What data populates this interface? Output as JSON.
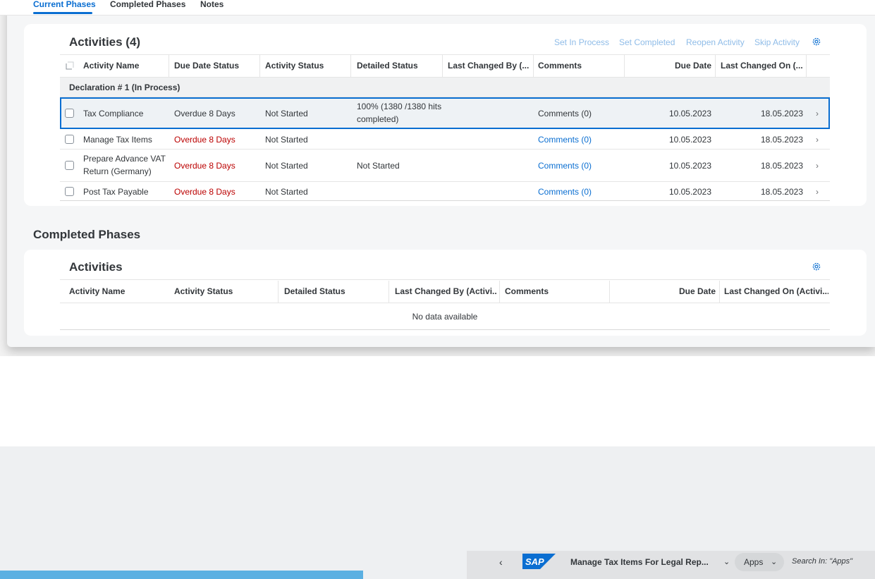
{
  "tabs": [
    {
      "label": "Current Phases",
      "active": true
    },
    {
      "label": "Completed Phases",
      "active": false
    },
    {
      "label": "Notes",
      "active": false
    }
  ],
  "current": {
    "title": "Activities (4)",
    "toolbar": [
      "Set In Process",
      "Set Completed",
      "Reopen Activity",
      "Skip Activity"
    ],
    "columns": [
      "Activity Name",
      "Due Date Status",
      "Activity Status",
      "Detailed Status",
      "Last Changed By (...",
      "Comments",
      "Due Date",
      "Last Changed On (..."
    ],
    "group": "Declaration # 1 (In Process)",
    "rows": [
      {
        "name": "Tax Compliance",
        "due_status": "Overdue 8 Days",
        "status": "Not Started",
        "detailed": "100% (1380 /1380 hits completed)",
        "comments": "Comments (0)",
        "due_date": "10.05.2023",
        "changed_on": "18.05.2023"
      },
      {
        "name": "Manage Tax Items",
        "due_status": "Overdue 8 Days",
        "status": "Not Started",
        "detailed": "",
        "comments": "Comments (0)",
        "due_date": "10.05.2023",
        "changed_on": "18.05.2023"
      },
      {
        "name": "Prepare Advance VAT Return (Germany)",
        "due_status": "Overdue 8 Days",
        "status": "Not Started",
        "detailed": "Not Started",
        "comments": "Comments (0)",
        "due_date": "10.05.2023",
        "changed_on": "18.05.2023"
      },
      {
        "name": "Post Tax Payable",
        "due_status": "Overdue 8 Days",
        "status": "Not Started",
        "detailed": "",
        "comments": "Comments (0)",
        "due_date": "10.05.2023",
        "changed_on": "18.05.2023"
      }
    ]
  },
  "completed": {
    "section_title": "Completed Phases",
    "title": "Activities",
    "columns": [
      "Activity Name",
      "Activity Status",
      "Detailed Status",
      "Last Changed By (Activi...",
      "Comments",
      "Due Date",
      "Last Changed On (Activi..."
    ],
    "empty": "No data available"
  },
  "shell": {
    "back": "‹",
    "logo": "SAP",
    "title": "Manage Tax Items For Legal Rep...",
    "apps": "Apps",
    "search": "Search In: \"Apps\""
  },
  "colors": {
    "accent": "#0a6ed1",
    "negative": "#bb0000",
    "muted_button": "#8fbce8"
  }
}
